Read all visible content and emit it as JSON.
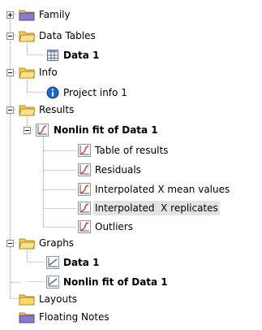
{
  "tree": {
    "family": {
      "label": "Family",
      "expanded": false
    },
    "data_tables": {
      "label": "Data Tables",
      "expanded": true,
      "items": [
        {
          "label": "Data 1"
        }
      ]
    },
    "info": {
      "label": "Info",
      "expanded": true,
      "items": [
        {
          "label": "Project info 1"
        }
      ]
    },
    "results": {
      "label": "Results",
      "expanded": true,
      "fit": {
        "label": "Nonlin fit of Data 1",
        "expanded": true,
        "items": [
          {
            "label": "Table of results"
          },
          {
            "label": "Residuals"
          },
          {
            "label": "Interpolated X mean values"
          },
          {
            "label": "Interpolated  X replicates"
          },
          {
            "label": "Outliers"
          }
        ]
      }
    },
    "graphs": {
      "label": "Graphs",
      "expanded": true,
      "items": [
        {
          "label": "Data 1"
        },
        {
          "label": "Nonlin fit of Data 1"
        }
      ]
    },
    "layouts": {
      "label": "Layouts"
    },
    "floating_notes": {
      "label": "Floating Notes"
    }
  },
  "colors": {
    "folder": "#f4cf57",
    "folder_purple": "#8f78c8",
    "selection": "#e3e3e3",
    "info_icon": "#1c67c9",
    "graph_red": "#d23b2a"
  },
  "icons": {
    "folder": "folder-icon",
    "family_folder": "family-folder-icon",
    "table": "data-table-icon",
    "info": "info-icon",
    "graph": "graph-icon",
    "floating_notes": "floating-notes-icon"
  }
}
